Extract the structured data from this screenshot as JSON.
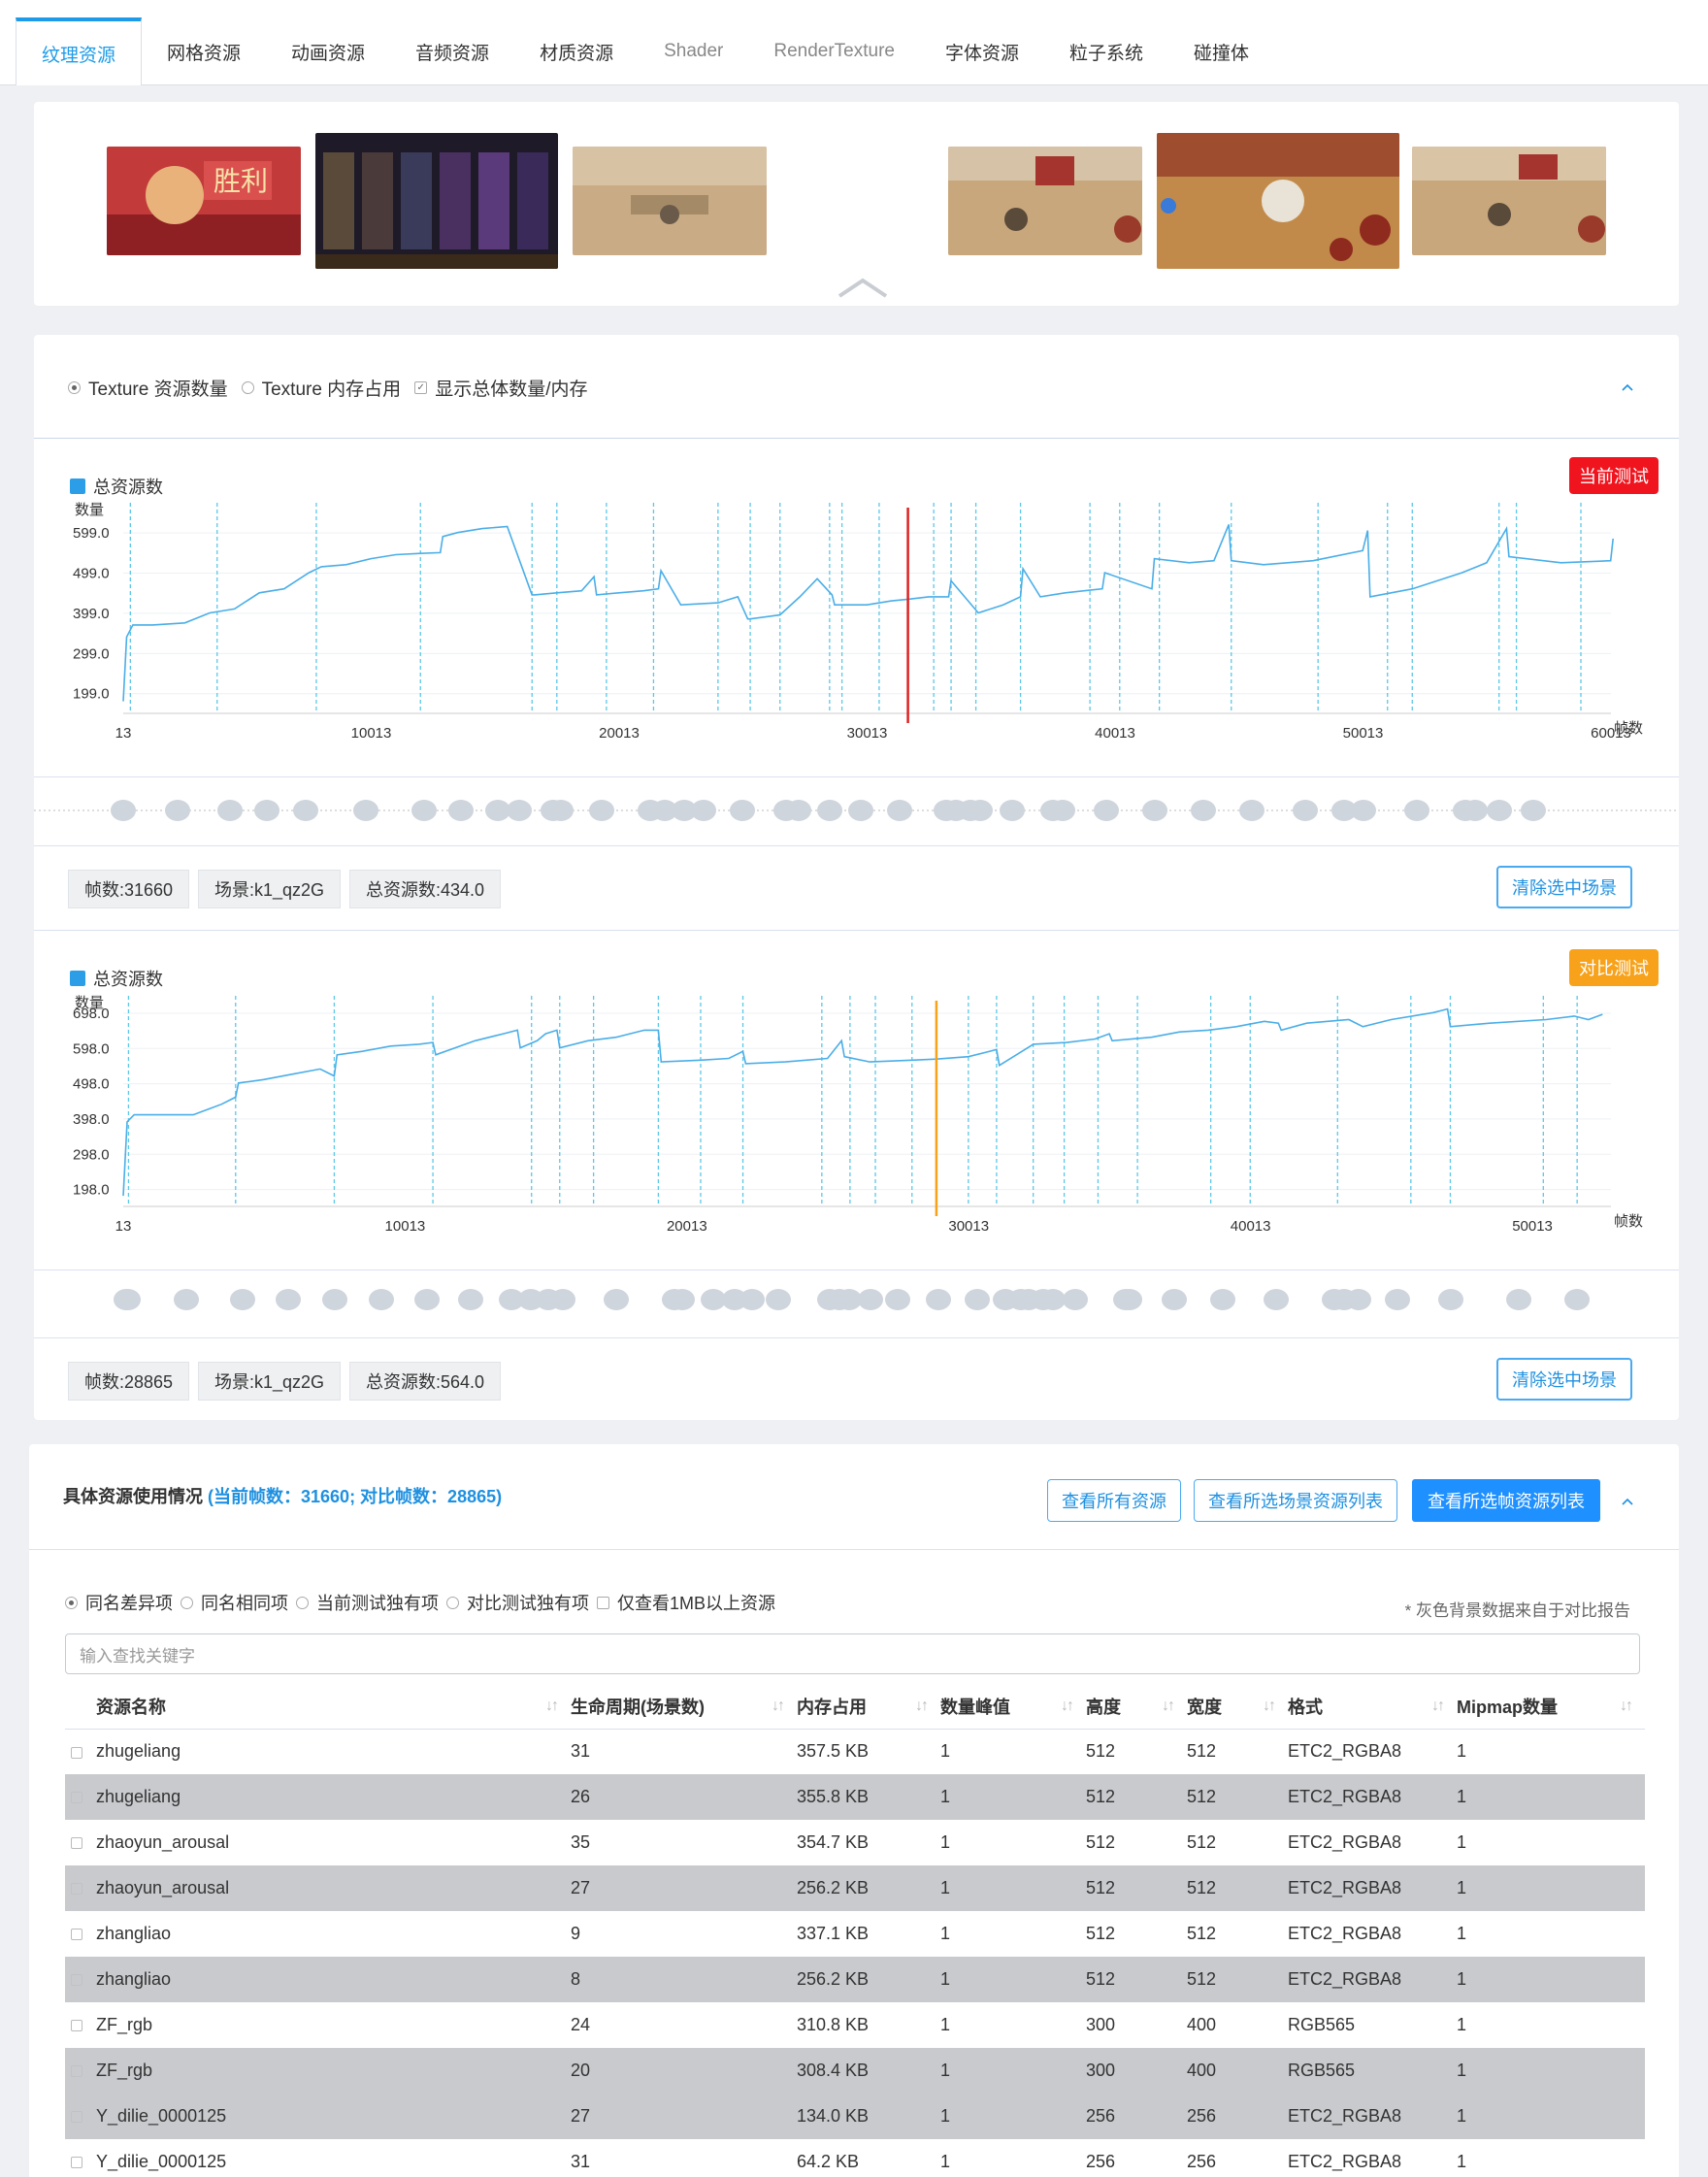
{
  "tabs": [
    "纹理资源",
    "网格资源",
    "动画资源",
    "音频资源",
    "材质资源",
    "Shader",
    "RenderTexture",
    "字体资源",
    "粒子系统",
    "碰撞体"
  ],
  "chart_options": {
    "radio1": "Texture 资源数量",
    "radio2": "Texture 内存占用",
    "check1": "显示总体数量/内存"
  },
  "chart1": {
    "legend": "总资源数",
    "tag": "当前测试",
    "info": {
      "frame": "帧数:31660",
      "scene": "场景:k1_qz2G",
      "total": "总资源数:434.0"
    },
    "clear_btn": "清除选中场景"
  },
  "chart2": {
    "legend": "总资源数",
    "tag": "对比测试",
    "info": {
      "frame": "帧数:28865",
      "scene": "场景:k1_qz2G",
      "total": "总资源数:564.0"
    },
    "clear_btn": "清除选中场景"
  },
  "chart_data": [
    {
      "type": "line",
      "legend": [
        "总资源数"
      ],
      "ylabel": "数量",
      "xlabel": "帧数",
      "y_ticks": [
        "599.0",
        "499.0",
        "399.0",
        "299.0",
        "199.0"
      ],
      "x_ticks": [
        "13",
        "10013",
        "20013",
        "30013",
        "40013",
        "50013",
        "60013"
      ],
      "xlim": [
        13,
        60013
      ],
      "ylim": [
        150,
        650
      ],
      "marker_x": 31660,
      "series": [
        {
          "x": [
            13,
            150,
            400,
            1200,
            2500,
            3500,
            4500,
            5500,
            6500,
            7500,
            8000,
            9000,
            10000,
            11000,
            12000,
            12800,
            12900,
            13500,
            14500,
            15500,
            16500,
            16600,
            17500,
            18500,
            19000,
            19100,
            20000,
            21000,
            21600,
            21700,
            22500,
            24000,
            24800,
            25200,
            25300,
            26500,
            27300,
            28000,
            28600,
            28700,
            30000,
            31000,
            31660,
            32500,
            33300,
            33400,
            34500,
            35500,
            36200,
            36300,
            37000,
            38000,
            39500,
            39600,
            41500,
            41600,
            43000,
            44000,
            44600,
            44700,
            46000,
            48000,
            50000,
            50200,
            50300,
            52000,
            54000,
            55000,
            55800,
            55900,
            58000,
            60000,
            60100
          ],
          "values": [
            180,
            340,
            370,
            370,
            375,
            400,
            410,
            450,
            460,
            500,
            515,
            520,
            535,
            545,
            548,
            550,
            590,
            600,
            610,
            615,
            445,
            445,
            450,
            455,
            490,
            445,
            450,
            455,
            460,
            505,
            420,
            425,
            440,
            385,
            385,
            395,
            440,
            485,
            445,
            420,
            420,
            430,
            434,
            440,
            440,
            480,
            400,
            420,
            440,
            510,
            440,
            450,
            460,
            500,
            460,
            535,
            525,
            530,
            620,
            530,
            520,
            530,
            555,
            605,
            440,
            460,
            500,
            525,
            610,
            540,
            525,
            530,
            585
          ]
        }
      ]
    },
    {
      "type": "line",
      "legend": [
        "总资源数"
      ],
      "ylabel": "数量",
      "xlabel": "帧数",
      "y_ticks": [
        "698.0",
        "598.0",
        "498.0",
        "398.0",
        "298.0",
        "198.0"
      ],
      "x_ticks": [
        "13",
        "10013",
        "20013",
        "30013",
        "40013",
        "50013"
      ],
      "xlim": [
        13,
        52800
      ],
      "ylim": [
        150,
        720
      ],
      "marker_x": 28865,
      "series": [
        {
          "x": [
            13,
            150,
            400,
            1500,
            2500,
            3500,
            4000,
            4100,
            5000,
            6000,
            7000,
            7500,
            7600,
            8500,
            9500,
            10500,
            11000,
            11100,
            12500,
            13500,
            14000,
            14100,
            14700,
            15000,
            15400,
            15500,
            16500,
            17500,
            18500,
            19000,
            19100,
            20500,
            21500,
            22000,
            22100,
            23500,
            25000,
            25500,
            25600,
            26500,
            28000,
            28865,
            30000,
            31000,
            31100,
            32200,
            32300,
            33500,
            34500,
            35000,
            35100,
            36500,
            37500,
            38500,
            39500,
            40500,
            41000,
            41100,
            42000,
            43500,
            44000,
            45000,
            46500,
            47000,
            47100,
            48500,
            50500,
            51500,
            52000,
            52500
          ],
          "values": [
            180,
            390,
            410,
            410,
            410,
            440,
            460,
            500,
            510,
            525,
            540,
            520,
            580,
            590,
            605,
            610,
            615,
            580,
            620,
            640,
            650,
            600,
            620,
            640,
            650,
            600,
            620,
            630,
            650,
            650,
            560,
            565,
            570,
            590,
            555,
            560,
            570,
            620,
            575,
            560,
            565,
            568,
            575,
            595,
            550,
            605,
            610,
            615,
            625,
            640,
            620,
            630,
            645,
            650,
            660,
            675,
            670,
            650,
            670,
            680,
            660,
            680,
            700,
            710,
            660,
            670,
            680,
            690,
            680,
            695
          ]
        }
      ]
    }
  ],
  "detail": {
    "title": "具体资源使用情况",
    "title_hl": "(当前帧数：31660; 对比帧数：28865)",
    "btn_all": "查看所有资源",
    "btn_scene": "查看所选场景资源列表",
    "btn_frame": "查看所选帧资源列表",
    "filters": [
      "同名差异项",
      "同名相同项",
      "当前测试独有项",
      "对比测试独有项"
    ],
    "filter_check": "仅查看1MB以上资源",
    "note": "* 灰色背景数据来自于对比报告",
    "search_placeholder": "输入查找关键字",
    "columns": [
      "资源名称",
      "生命周期(场景数)",
      "内存占用",
      "数量峰值",
      "高度",
      "宽度",
      "格式",
      "Mipmap数量"
    ],
    "rows": [
      {
        "name": "zhugeliang",
        "life": "31",
        "mem": "357.5 KB",
        "peak": "1",
        "h": "512",
        "w": "512",
        "fmt": "ETC2_RGBA8",
        "mip": "1",
        "gray": false
      },
      {
        "name": "zhugeliang",
        "life": "26",
        "mem": "355.8 KB",
        "peak": "1",
        "h": "512",
        "w": "512",
        "fmt": "ETC2_RGBA8",
        "mip": "1",
        "gray": true
      },
      {
        "name": "zhaoyun_arousal",
        "life": "35",
        "mem": "354.7 KB",
        "peak": "1",
        "h": "512",
        "w": "512",
        "fmt": "ETC2_RGBA8",
        "mip": "1",
        "gray": false
      },
      {
        "name": "zhaoyun_arousal",
        "life": "27",
        "mem": "256.2 KB",
        "peak": "1",
        "h": "512",
        "w": "512",
        "fmt": "ETC2_RGBA8",
        "mip": "1",
        "gray": true
      },
      {
        "name": "zhangliao",
        "life": "9",
        "mem": "337.1 KB",
        "peak": "1",
        "h": "512",
        "w": "512",
        "fmt": "ETC2_RGBA8",
        "mip": "1",
        "gray": false
      },
      {
        "name": "zhangliao",
        "life": "8",
        "mem": "256.2 KB",
        "peak": "1",
        "h": "512",
        "w": "512",
        "fmt": "ETC2_RGBA8",
        "mip": "1",
        "gray": true
      },
      {
        "name": "ZF_rgb",
        "life": "24",
        "mem": "310.8 KB",
        "peak": "1",
        "h": "300",
        "w": "400",
        "fmt": "RGB565",
        "mip": "1",
        "gray": false
      },
      {
        "name": "ZF_rgb",
        "life": "20",
        "mem": "308.4 KB",
        "peak": "1",
        "h": "300",
        "w": "400",
        "fmt": "RGB565",
        "mip": "1",
        "gray": true
      },
      {
        "name": "Y_dilie_0000125",
        "life": "27",
        "mem": "134.0 KB",
        "peak": "1",
        "h": "256",
        "w": "256",
        "fmt": "ETC2_RGBA8",
        "mip": "1",
        "gray": true
      },
      {
        "name": "Y_dilie_0000125",
        "life": "31",
        "mem": "64.2 KB",
        "peak": "1",
        "h": "256",
        "w": "256",
        "fmt": "ETC2_RGBA8",
        "mip": "1",
        "gray": false
      }
    ]
  }
}
